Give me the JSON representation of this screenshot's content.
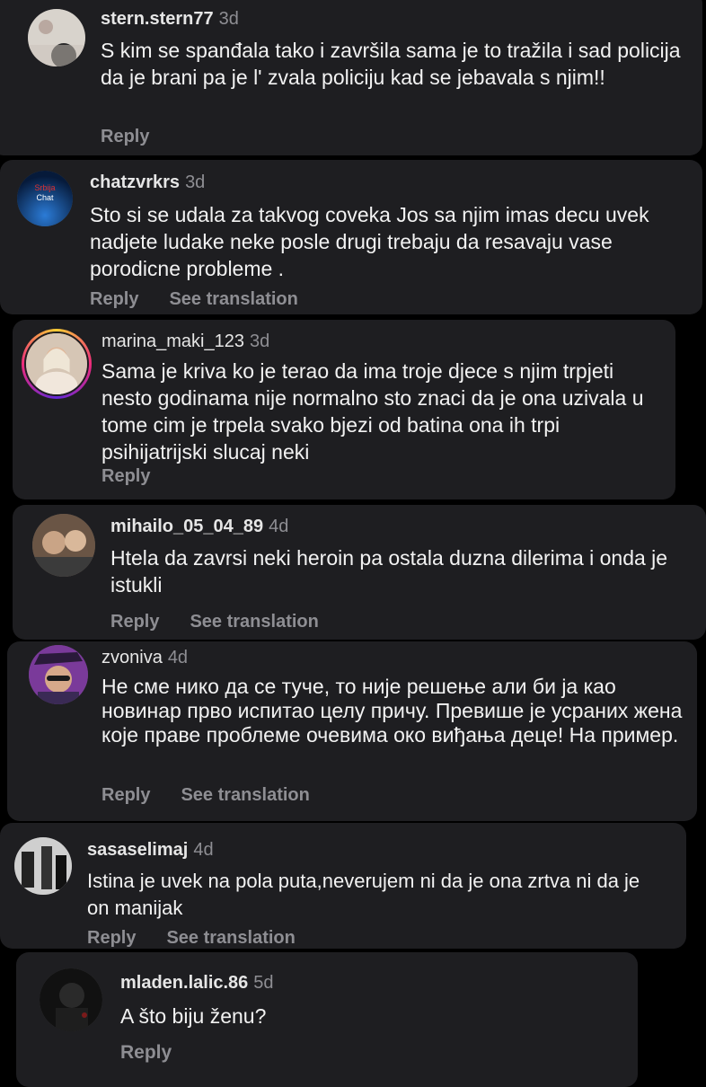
{
  "comments": [
    {
      "username": "stern.stern77",
      "time": "3d",
      "text": "S kim se spanđala tako i završila sama je to tražila i sad policija da je brani pa je l' zvala policiju kad se jebavala s njim!!",
      "reply": "Reply"
    },
    {
      "username": "chatzvrkrs",
      "time": "3d",
      "text": "Sto si se udala za takvog coveka Jos sa njim imas decu uvek nadjete ludake neke posle drugi trebaju da resavaju vase porodicne probleme .",
      "reply": "Reply",
      "translate": "See translation",
      "avatar_text": "Srbija Chat"
    },
    {
      "username": "marina_maki_123",
      "time": "3d",
      "text": "Sama je kriva ko je terao da ima troje djece s njim  trpjeti nesto godinama nije normalno sto znaci da je ona uzivala u tome cim je trpela svako bjezi od batina ona ih trpi psihijatrijski slucaj neki",
      "reply": "Reply"
    },
    {
      "username": "mihailo_05_04_89",
      "time": "4d",
      "text": "Htela da zavrsi neki heroin pa ostala duzna dilerima i onda je istukli",
      "reply": "Reply",
      "translate": "See translation"
    },
    {
      "username": "zvoniva",
      "time": "4d",
      "text": "Не сме нико да се туче, то није решење али би ја као новинар прво испитао целу причу. Превише је усраних жена које праве проблеме очевима око виђања деце! На пример.",
      "reply": "Reply",
      "translate": "See translation"
    },
    {
      "username": "sasaselimaj",
      "time": "4d",
      "text": "Istina je uvek na pola puta,neverujem ni da je ona zrtva ni da je on manijak",
      "reply": "Reply",
      "translate": "See translation"
    },
    {
      "username": "mladen.lalic.86",
      "time": "5d",
      "text": "A što biju ženu?",
      "reply": "Reply"
    }
  ]
}
